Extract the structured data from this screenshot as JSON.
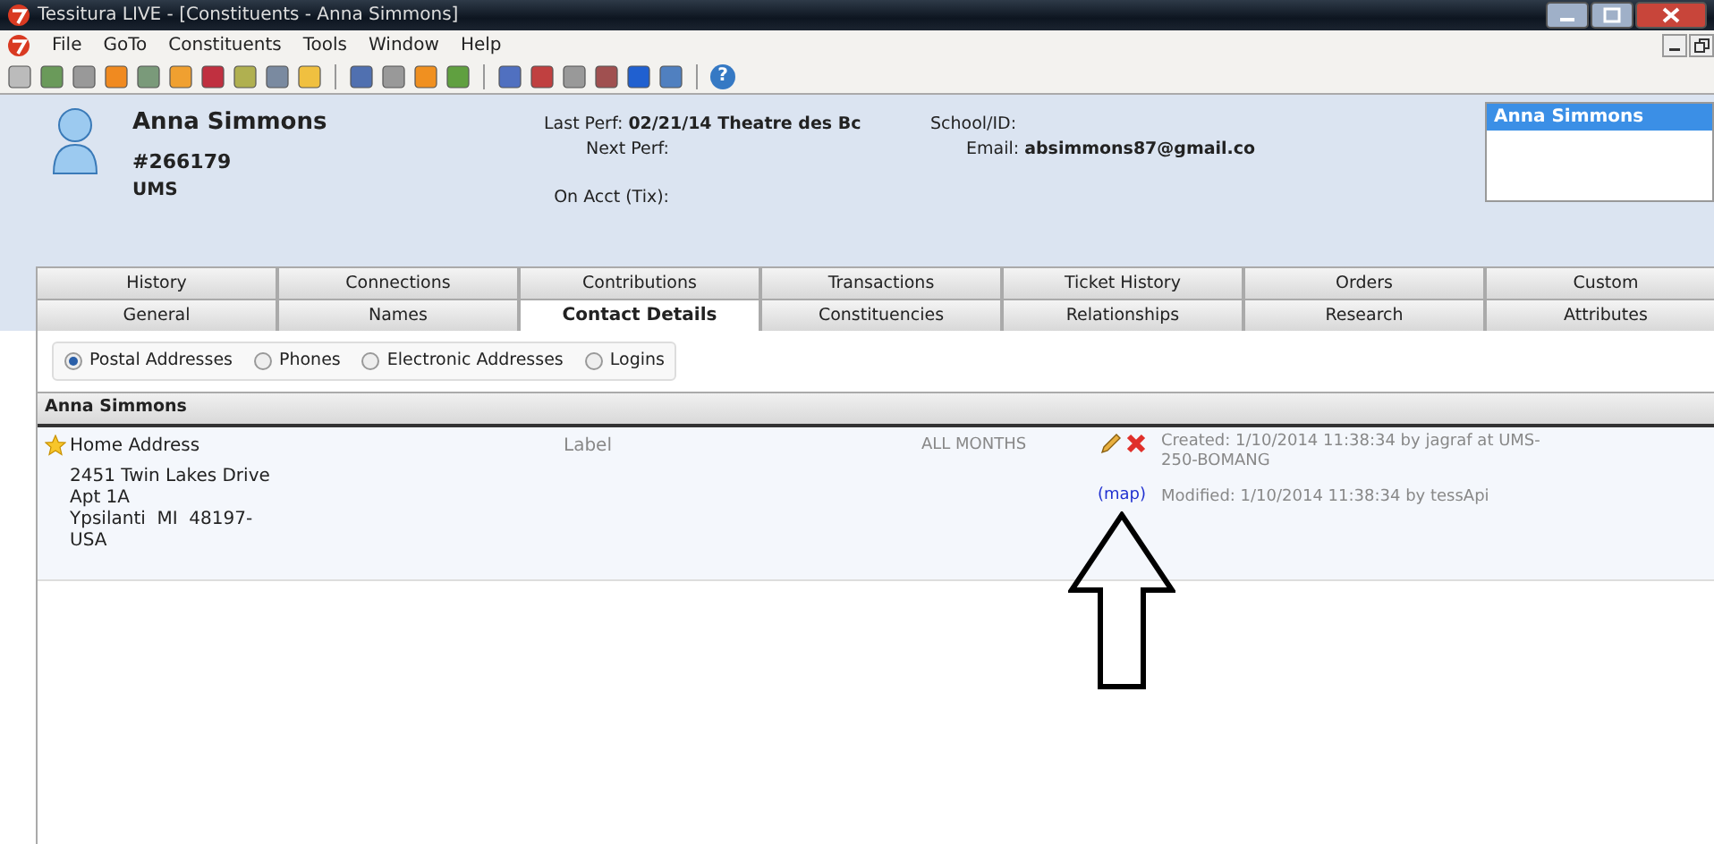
{
  "window": {
    "title": "Tessitura  LIVE - [Constituents - Anna Simmons]"
  },
  "menu": [
    "File",
    "GoTo",
    "Constituents",
    "Tools",
    "Window",
    "Help"
  ],
  "toolbar": {
    "help_glyph": "?"
  },
  "header": {
    "name": "Anna Simmons",
    "number": "#266179",
    "org": "UMS",
    "last_perf_label": "Last Perf:",
    "last_perf_value": "02/21/14 Theatre des Bc",
    "next_perf_label": "Next Perf:",
    "on_acct_label": "On Acct (Tix):",
    "school_label": "School/ID:",
    "email_label": "Email:",
    "email_value": "absimmons87@gmail.co",
    "list": [
      {
        "label": "Anna Simmons",
        "selected": true
      }
    ]
  },
  "tab_rows": [
    [
      {
        "label": "History",
        "selected": false
      },
      {
        "label": "Connections",
        "selected": false
      },
      {
        "label": "Contributions",
        "selected": false
      },
      {
        "label": "Transactions",
        "selected": false
      },
      {
        "label": "Ticket History",
        "selected": false
      },
      {
        "label": "Orders",
        "selected": false
      },
      {
        "label": "Custom",
        "selected": false
      }
    ],
    [
      {
        "label": "General",
        "selected": false
      },
      {
        "label": "Names",
        "selected": false
      },
      {
        "label": "Contact Details",
        "selected": true
      },
      {
        "label": "Constituencies",
        "selected": false
      },
      {
        "label": "Relationships",
        "selected": false
      },
      {
        "label": "Research",
        "selected": false
      },
      {
        "label": "Attributes",
        "selected": false
      }
    ]
  ],
  "radios": [
    {
      "label": "Postal Addresses",
      "selected": true
    },
    {
      "label": "Phones",
      "selected": false
    },
    {
      "label": "Electronic Addresses",
      "selected": false
    },
    {
      "label": "Logins",
      "selected": false
    }
  ],
  "section": {
    "title": "Anna Simmons"
  },
  "addresses": [
    {
      "primary": true,
      "type": "Home Address",
      "lines": [
        "2451 Twin Lakes Drive",
        "Apt 1A",
        "Ypsilanti  MI  48197-",
        "USA"
      ],
      "label": "Label",
      "months": "ALL MONTHS",
      "map_link": "(map)",
      "created": "Created: 1/10/2014 11:38:34 by jagraf at UMS-250-BOMANG",
      "modified": "Modified: 1/10/2014 11:38:34 by tessApi"
    }
  ]
}
